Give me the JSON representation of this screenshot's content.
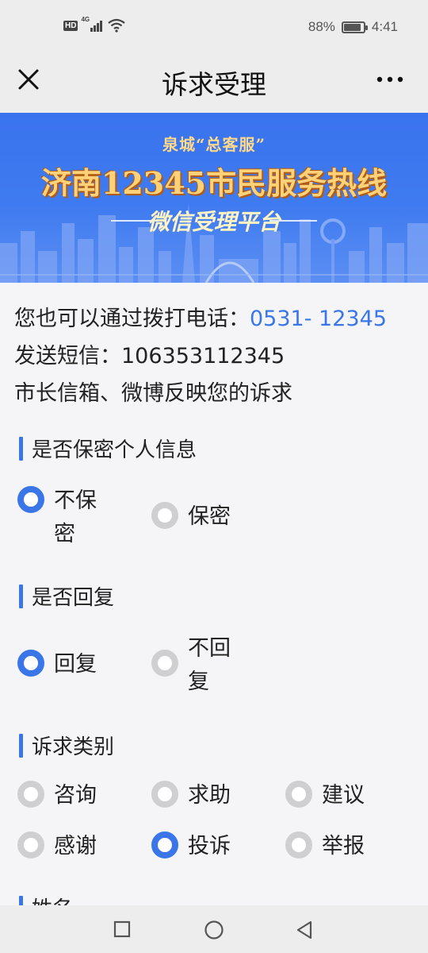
{
  "status_bar": {
    "network_badge": "HD",
    "network_gen": "4G",
    "battery_percent": "88%",
    "battery_level": 0.88,
    "time": "4:41"
  },
  "header": {
    "title": "诉求受理",
    "close_icon": "close-icon",
    "more_icon": "more-dots-icon"
  },
  "banner": {
    "top_text": "泉城“总客服”",
    "main_text": "济南12345市民服务热线",
    "sub_text": "微信受理平台"
  },
  "intro": {
    "line1_prefix": "您也可以通过拨打电话：",
    "phone": "0531- 12345",
    "line2": "发送短信：106353112345",
    "line3": "市长信箱、微博反映您的诉求"
  },
  "privacy": {
    "title": "是否保密个人信息",
    "options": [
      "不保密",
      "保密"
    ],
    "selected": "不保密"
  },
  "reply": {
    "title": "是否回复",
    "options": [
      "回复",
      "不回复"
    ],
    "selected": "回复"
  },
  "category": {
    "title": "诉求类别",
    "options": [
      "咨询",
      "求助",
      "建议",
      "感谢",
      "投诉",
      "举报"
    ],
    "selected": "投诉"
  },
  "name_section": {
    "title": "姓名"
  },
  "colors": {
    "accent": "#3a76e8",
    "radio_off": "#cfcfd2",
    "banner_blue": "#3f7bf0",
    "banner_gold": "#ffd27a"
  }
}
